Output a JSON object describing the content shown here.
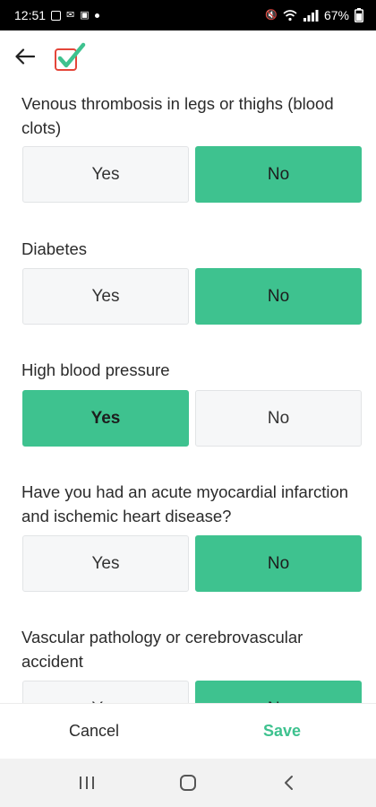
{
  "status_bar": {
    "time": "12:51",
    "battery": "67%"
  },
  "questions": [
    {
      "text": "Venous thrombosis in legs or thighs (blood clots)",
      "yes": "Yes",
      "no": "No",
      "selected": "no"
    },
    {
      "text": "Diabetes",
      "yes": "Yes",
      "no": "No",
      "selected": "no"
    },
    {
      "text": "High blood pressure",
      "yes": "Yes",
      "no": "No",
      "selected": "yes"
    },
    {
      "text": "Have you had an acute myocardial infarction and ischemic heart disease?",
      "yes": "Yes",
      "no": "No",
      "selected": "no"
    },
    {
      "text": "Vascular pathology or cerebrovascular accident",
      "yes": "Yes",
      "no": "No",
      "selected": "no"
    }
  ],
  "footer": {
    "cancel_label": "Cancel",
    "save_label": "Save"
  },
  "colors": {
    "accent": "#3ec28f",
    "logo_check": "#3ec28f",
    "logo_box": "#e4463a"
  },
  "icons": [
    "back-arrow-icon",
    "checklist-logo-icon",
    "recent-apps-icon",
    "home-icon",
    "system-back-icon"
  ]
}
